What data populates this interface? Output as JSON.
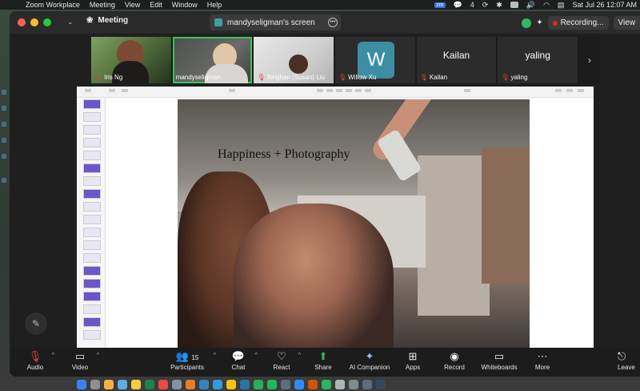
{
  "menubar": {
    "app_name": "Zoom Workplace",
    "menus": [
      "Meeting",
      "View",
      "Edit",
      "Window",
      "Help"
    ],
    "notification_count": "4",
    "zm_badge": "zm",
    "datetime": "Sat Jul 26  12:07 AM"
  },
  "titlebar": {
    "meeting_label": "Meeting",
    "screen_label": "mandyseligman's screen",
    "recording_label": "Recording...",
    "view_label": "View"
  },
  "participants": [
    {
      "name": "Iris Ng",
      "muted": true,
      "type": "video"
    },
    {
      "name": "mandyseligman",
      "muted": false,
      "type": "video",
      "active": true
    },
    {
      "name": "Xinghan (Susan) Liu",
      "muted": true,
      "type": "video"
    },
    {
      "name": "Willow Xu",
      "muted": true,
      "type": "avatar",
      "initial": "W",
      "avatar_color": "#3d8da3"
    },
    {
      "name": "Kailan",
      "muted": true,
      "type": "name"
    },
    {
      "name": "yaling",
      "muted": true,
      "type": "name"
    }
  ],
  "slide": {
    "title": "Happiness + Photography"
  },
  "controls": {
    "audio": "Audio",
    "video": "Video",
    "participants": "Participants",
    "participants_count": "15",
    "chat": "Chat",
    "react": "React",
    "share": "Share",
    "ai_companion": "AI Companion",
    "apps": "Apps",
    "record": "Record",
    "whiteboards": "Whiteboards",
    "more": "More",
    "leave": "Leave"
  },
  "colors": {
    "accent_green": "#2dbb5d",
    "mute_red": "#e04040",
    "active_outline": "#35c759"
  }
}
